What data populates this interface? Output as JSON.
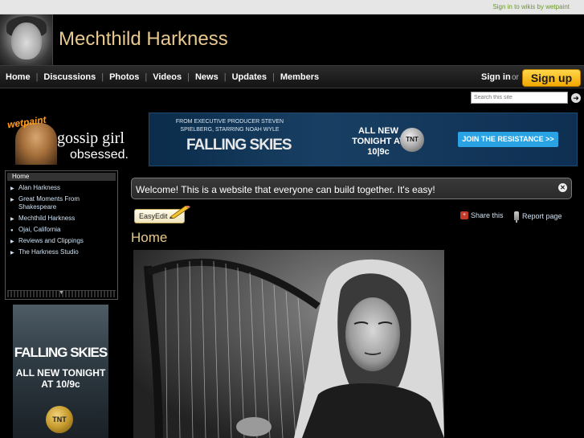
{
  "topbar": {
    "signin_link": "Sign in to wikis by wetpaint"
  },
  "header": {
    "site_title": "Mechthild Harkness"
  },
  "nav": {
    "items": [
      "Home",
      "Discussions",
      "Photos",
      "Videos",
      "News",
      "Updates",
      "Members"
    ],
    "signin_label": "Sign in",
    "or_text": "or",
    "signup_label": "Sign up"
  },
  "search": {
    "placeholder": "Search this site"
  },
  "ads": {
    "gossip_logo": "wetpaint",
    "gossip_title": "gossip girl",
    "gossip_tagline": "obsessed.",
    "banner_exec": "FROM EXECUTIVE PRODUCER STEVEN SPIELBERG, STARRING NOAH WYLE",
    "banner_logo": "FALLING SKIES",
    "banner_allnew": "ALL NEW TONIGHT AT 10|9c",
    "banner_network": "TNT",
    "banner_cta": "JOIN THE RESISTANCE >>",
    "side_logo": "FALLING SKIES",
    "side_text": "ALL NEW TONIGHT AT 10/9c",
    "side_network": "TNT"
  },
  "sidebar": {
    "items": [
      {
        "label": "Home"
      },
      {
        "label": "Alan Harkness"
      },
      {
        "label": "Great Moments From Shakespeare"
      },
      {
        "label": "Mechthild Harkness"
      },
      {
        "label": "Ojai, California"
      },
      {
        "label": "Reviews and Clippings"
      },
      {
        "label": "The Harkness Studio"
      }
    ]
  },
  "main": {
    "welcome_text": "Welcome! This is a website that everyone can build together. It's easy!",
    "easyedit_label": "EasyEdit",
    "share_label": "Share this",
    "report_label": "Report page",
    "heading": "Home"
  }
}
